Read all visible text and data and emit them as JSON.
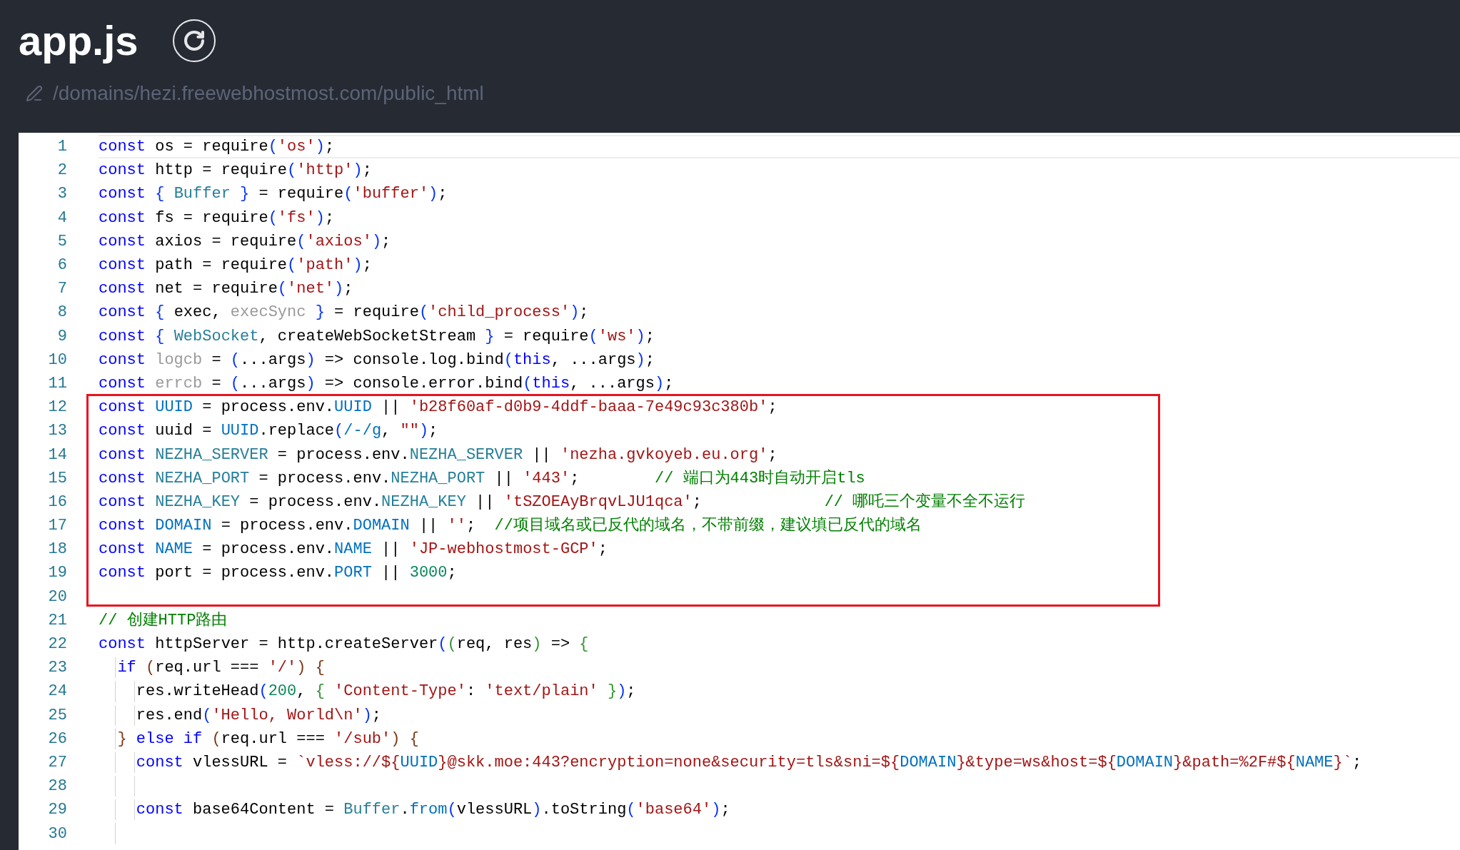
{
  "file": {
    "title": "app.js",
    "path": "/domains/hezi.freewebhostmost.com/public_html"
  },
  "editor": {
    "lines": [
      {
        "number": "1",
        "current": true,
        "tokens": [
          {
            "kind": "keyword",
            "text": "const "
          },
          {
            "kind": "plain",
            "text": "os = require"
          },
          {
            "kind": "bracket1",
            "text": "("
          },
          {
            "kind": "string",
            "text": "'os'"
          },
          {
            "kind": "bracket1",
            "text": ")"
          },
          {
            "kind": "plain",
            "text": ";"
          }
        ]
      },
      {
        "number": "2",
        "current": false,
        "tokens": [
          {
            "kind": "keyword",
            "text": "const "
          },
          {
            "kind": "plain",
            "text": "http = require"
          },
          {
            "kind": "bracket1",
            "text": "("
          },
          {
            "kind": "string",
            "text": "'http'"
          },
          {
            "kind": "bracket1",
            "text": ")"
          },
          {
            "kind": "plain",
            "text": ";"
          }
        ]
      },
      {
        "number": "3",
        "current": false,
        "tokens": [
          {
            "kind": "keyword",
            "text": "const "
          },
          {
            "kind": "bracket1",
            "text": "{ "
          },
          {
            "kind": "type",
            "text": "Buffer "
          },
          {
            "kind": "bracket1",
            "text": "}"
          },
          {
            "kind": "plain",
            "text": " = require"
          },
          {
            "kind": "bracket1",
            "text": "("
          },
          {
            "kind": "string",
            "text": "'buffer'"
          },
          {
            "kind": "bracket1",
            "text": ")"
          },
          {
            "kind": "plain",
            "text": ";"
          }
        ]
      },
      {
        "number": "4",
        "current": false,
        "tokens": [
          {
            "kind": "keyword",
            "text": "const "
          },
          {
            "kind": "plain",
            "text": "fs = require"
          },
          {
            "kind": "bracket1",
            "text": "("
          },
          {
            "kind": "string",
            "text": "'fs'"
          },
          {
            "kind": "bracket1",
            "text": ")"
          },
          {
            "kind": "plain",
            "text": ";"
          }
        ]
      },
      {
        "number": "5",
        "current": false,
        "tokens": [
          {
            "kind": "keyword",
            "text": "const "
          },
          {
            "kind": "plain",
            "text": "axios = require"
          },
          {
            "kind": "bracket1",
            "text": "("
          },
          {
            "kind": "string",
            "text": "'axios'"
          },
          {
            "kind": "bracket1",
            "text": ")"
          },
          {
            "kind": "plain",
            "text": ";"
          }
        ]
      },
      {
        "number": "6",
        "current": false,
        "tokens": [
          {
            "kind": "keyword",
            "text": "const "
          },
          {
            "kind": "plain",
            "text": "path = require"
          },
          {
            "kind": "bracket1",
            "text": "("
          },
          {
            "kind": "string",
            "text": "'path'"
          },
          {
            "kind": "bracket1",
            "text": ")"
          },
          {
            "kind": "plain",
            "text": ";"
          }
        ]
      },
      {
        "number": "7",
        "current": false,
        "tokens": [
          {
            "kind": "keyword",
            "text": "const "
          },
          {
            "kind": "plain",
            "text": "net = require"
          },
          {
            "kind": "bracket1",
            "text": "("
          },
          {
            "kind": "string",
            "text": "'net'"
          },
          {
            "kind": "bracket1",
            "text": ")"
          },
          {
            "kind": "plain",
            "text": ";"
          }
        ]
      },
      {
        "number": "8",
        "current": false,
        "tokens": [
          {
            "kind": "keyword",
            "text": "const "
          },
          {
            "kind": "bracket1",
            "text": "{ "
          },
          {
            "kind": "plain",
            "text": "exec, "
          },
          {
            "kind": "unused",
            "text": "execSync "
          },
          {
            "kind": "bracket1",
            "text": "}"
          },
          {
            "kind": "plain",
            "text": " = require"
          },
          {
            "kind": "bracket1",
            "text": "("
          },
          {
            "kind": "string",
            "text": "'child_process'"
          },
          {
            "kind": "bracket1",
            "text": ")"
          },
          {
            "kind": "plain",
            "text": ";"
          }
        ]
      },
      {
        "number": "9",
        "current": false,
        "tokens": [
          {
            "kind": "keyword",
            "text": "const "
          },
          {
            "kind": "bracket1",
            "text": "{ "
          },
          {
            "kind": "type",
            "text": "WebSocket"
          },
          {
            "kind": "plain",
            "text": ", createWebSocketStream "
          },
          {
            "kind": "bracket1",
            "text": "}"
          },
          {
            "kind": "plain",
            "text": " = require"
          },
          {
            "kind": "bracket1",
            "text": "("
          },
          {
            "kind": "string",
            "text": "'ws'"
          },
          {
            "kind": "bracket1",
            "text": ")"
          },
          {
            "kind": "plain",
            "text": ";"
          }
        ]
      },
      {
        "number": "10",
        "current": false,
        "tokens": [
          {
            "kind": "keyword",
            "text": "const "
          },
          {
            "kind": "unused",
            "text": "logcb"
          },
          {
            "kind": "plain",
            "text": " = "
          },
          {
            "kind": "bracket1",
            "text": "("
          },
          {
            "kind": "plain",
            "text": "...args"
          },
          {
            "kind": "bracket1",
            "text": ")"
          },
          {
            "kind": "plain",
            "text": " => console.log.bind"
          },
          {
            "kind": "bracket1",
            "text": "("
          },
          {
            "kind": "keyword",
            "text": "this"
          },
          {
            "kind": "plain",
            "text": ", ...args"
          },
          {
            "kind": "bracket1",
            "text": ")"
          },
          {
            "kind": "plain",
            "text": ";"
          }
        ]
      },
      {
        "number": "11",
        "current": false,
        "tokens": [
          {
            "kind": "keyword",
            "text": "const "
          },
          {
            "kind": "unused",
            "text": "errcb"
          },
          {
            "kind": "plain",
            "text": " = "
          },
          {
            "kind": "bracket1",
            "text": "("
          },
          {
            "kind": "plain",
            "text": "...args"
          },
          {
            "kind": "bracket1",
            "text": ")"
          },
          {
            "kind": "plain",
            "text": " => console.error.bind"
          },
          {
            "kind": "bracket1",
            "text": "("
          },
          {
            "kind": "keyword",
            "text": "this"
          },
          {
            "kind": "plain",
            "text": ", ...args"
          },
          {
            "kind": "bracket1",
            "text": ")"
          },
          {
            "kind": "plain",
            "text": ";"
          }
        ]
      },
      {
        "number": "12",
        "current": false,
        "tokens": [
          {
            "kind": "keyword",
            "text": "const "
          },
          {
            "kind": "constant",
            "text": "UUID"
          },
          {
            "kind": "plain",
            "text": " = process.env."
          },
          {
            "kind": "constant",
            "text": "UUID"
          },
          {
            "kind": "plain",
            "text": " || "
          },
          {
            "kind": "string",
            "text": "'b28f60af-d0b9-4ddf-baaa-7e49c93c380b'"
          },
          {
            "kind": "plain",
            "text": ";"
          }
        ]
      },
      {
        "number": "13",
        "current": false,
        "tokens": [
          {
            "kind": "keyword",
            "text": "const "
          },
          {
            "kind": "plain",
            "text": "uuid = "
          },
          {
            "kind": "constant",
            "text": "UUID"
          },
          {
            "kind": "plain",
            "text": ".replace"
          },
          {
            "kind": "bracket1",
            "text": "("
          },
          {
            "kind": "constant",
            "text": "/-/g"
          },
          {
            "kind": "plain",
            "text": ", "
          },
          {
            "kind": "string",
            "text": "\"\""
          },
          {
            "kind": "bracket1",
            "text": ")"
          },
          {
            "kind": "plain",
            "text": ";"
          }
        ]
      },
      {
        "number": "14",
        "current": false,
        "tokens": [
          {
            "kind": "keyword",
            "text": "const "
          },
          {
            "kind": "type",
            "text": "NEZHA_SERVER"
          },
          {
            "kind": "plain",
            "text": " = process.env."
          },
          {
            "kind": "type",
            "text": "NEZHA_SERVER"
          },
          {
            "kind": "plain",
            "text": " || "
          },
          {
            "kind": "string",
            "text": "'nezha.gvkoyeb.eu.org'"
          },
          {
            "kind": "plain",
            "text": ";"
          }
        ]
      },
      {
        "number": "15",
        "current": false,
        "tokens": [
          {
            "kind": "keyword",
            "text": "const "
          },
          {
            "kind": "type",
            "text": "NEZHA_PORT"
          },
          {
            "kind": "plain",
            "text": " = process.env."
          },
          {
            "kind": "type",
            "text": "NEZHA_PORT"
          },
          {
            "kind": "plain",
            "text": " || "
          },
          {
            "kind": "string",
            "text": "'443'"
          },
          {
            "kind": "plain",
            "text": ";        "
          },
          {
            "kind": "comment",
            "text": "// 端口为443时自动开启tls"
          }
        ]
      },
      {
        "number": "16",
        "current": false,
        "tokens": [
          {
            "kind": "keyword",
            "text": "const "
          },
          {
            "kind": "type",
            "text": "NEZHA_KEY"
          },
          {
            "kind": "plain",
            "text": " = process.env."
          },
          {
            "kind": "type",
            "text": "NEZHA_KEY"
          },
          {
            "kind": "plain",
            "text": " || "
          },
          {
            "kind": "string",
            "text": "'tSZOEAyBrqvLJU1qca'"
          },
          {
            "kind": "plain",
            "text": ";             "
          },
          {
            "kind": "comment",
            "text": "// 哪吒三个变量不全不运行"
          }
        ]
      },
      {
        "number": "17",
        "current": false,
        "tokens": [
          {
            "kind": "keyword",
            "text": "const "
          },
          {
            "kind": "constant",
            "text": "DOMAIN"
          },
          {
            "kind": "plain",
            "text": " = process.env."
          },
          {
            "kind": "constant",
            "text": "DOMAIN"
          },
          {
            "kind": "plain",
            "text": " || "
          },
          {
            "kind": "string",
            "text": "''"
          },
          {
            "kind": "plain",
            "text": ";  "
          },
          {
            "kind": "comment",
            "text": "//项目域名或已反代的域名，不带前缀，建议填已反代的域名"
          }
        ]
      },
      {
        "number": "18",
        "current": false,
        "tokens": [
          {
            "kind": "keyword",
            "text": "const "
          },
          {
            "kind": "constant",
            "text": "NAME"
          },
          {
            "kind": "plain",
            "text": " = process.env."
          },
          {
            "kind": "constant",
            "text": "NAME"
          },
          {
            "kind": "plain",
            "text": " || "
          },
          {
            "kind": "string",
            "text": "'JP-webhostmost-GCP'"
          },
          {
            "kind": "plain",
            "text": ";"
          }
        ]
      },
      {
        "number": "19",
        "current": false,
        "tokens": [
          {
            "kind": "keyword",
            "text": "const "
          },
          {
            "kind": "plain",
            "text": "port = process.env."
          },
          {
            "kind": "constant",
            "text": "PORT"
          },
          {
            "kind": "plain",
            "text": " || "
          },
          {
            "kind": "number",
            "text": "3000"
          },
          {
            "kind": "plain",
            "text": ";"
          }
        ]
      },
      {
        "number": "20",
        "current": false
      },
      {
        "number": "21",
        "current": false,
        "tokens": [
          {
            "kind": "comment",
            "text": "// 创建HTTP路由"
          }
        ]
      },
      {
        "number": "22",
        "current": false,
        "tokens": [
          {
            "kind": "keyword",
            "text": "const "
          },
          {
            "kind": "plain",
            "text": "httpServer = http.createServer"
          },
          {
            "kind": "bracket1",
            "text": "("
          },
          {
            "kind": "bracket2",
            "text": "("
          },
          {
            "kind": "plain",
            "text": "req, res"
          },
          {
            "kind": "bracket2",
            "text": ")"
          },
          {
            "kind": "plain",
            "text": " => "
          },
          {
            "kind": "bracket2",
            "text": "{"
          }
        ],
        "children": [
          {
            "number": "23",
            "current": false,
            "tokens": [
              {
                "kind": "keyword",
                "text": "if "
              },
              {
                "kind": "bracket3",
                "text": "("
              },
              {
                "kind": "plain",
                "text": "req.url === "
              },
              {
                "kind": "string",
                "text": "'/'"
              },
              {
                "kind": "bracket3",
                "text": ")"
              },
              {
                "kind": "bracket3",
                "text": " {"
              }
            ],
            "children": [
              {
                "number": "24",
                "current": false,
                "tokens": [
                  {
                    "kind": "plain",
                    "text": "res.writeHead"
                  },
                  {
                    "kind": "bracket1",
                    "text": "("
                  },
                  {
                    "kind": "number",
                    "text": "200"
                  },
                  {
                    "kind": "plain",
                    "text": ", "
                  },
                  {
                    "kind": "bracket2",
                    "text": "{ "
                  },
                  {
                    "kind": "string",
                    "text": "'Content-Type'"
                  },
                  {
                    "kind": "plain",
                    "text": ": "
                  },
                  {
                    "kind": "string",
                    "text": "'text/plain'"
                  },
                  {
                    "kind": "bracket2",
                    "text": " }"
                  },
                  {
                    "kind": "bracket1",
                    "text": ")"
                  },
                  {
                    "kind": "plain",
                    "text": ";"
                  }
                ]
              },
              {
                "number": "25",
                "current": false,
                "tokens": [
                  {
                    "kind": "plain",
                    "text": "res.end"
                  },
                  {
                    "kind": "bracket1",
                    "text": "("
                  },
                  {
                    "kind": "string",
                    "text": "'Hello, World\\n'"
                  },
                  {
                    "kind": "bracket1",
                    "text": ")"
                  },
                  {
                    "kind": "plain",
                    "text": ";"
                  }
                ]
              }
            ]
          },
          {
            "number": "26",
            "current": false,
            "tokens": [
              {
                "kind": "bracket3",
                "text": "}"
              },
              {
                "kind": "keyword",
                "text": " else if "
              },
              {
                "kind": "bracket3",
                "text": "("
              },
              {
                "kind": "plain",
                "text": "req.url === "
              },
              {
                "kind": "string",
                "text": "'/sub'"
              },
              {
                "kind": "bracket3",
                "text": ")"
              },
              {
                "kind": "bracket3",
                "text": " {"
              }
            ],
            "children": [
              {
                "number": "27",
                "current": false,
                "tokens": [
                  {
                    "kind": "keyword",
                    "text": "const "
                  },
                  {
                    "kind": "plain",
                    "text": "vlessURL = "
                  },
                  {
                    "kind": "string",
                    "text": "`vless://${"
                  },
                  {
                    "kind": "constant",
                    "text": "UUID"
                  },
                  {
                    "kind": "string",
                    "text": "}@skk.moe:443?encryption=none&security=tls&sni=${"
                  },
                  {
                    "kind": "constant",
                    "text": "DOMAIN"
                  },
                  {
                    "kind": "string",
                    "text": "}&type=ws&host=${"
                  },
                  {
                    "kind": "constant",
                    "text": "DOMAIN"
                  },
                  {
                    "kind": "string",
                    "text": "}&path=%2F#${"
                  },
                  {
                    "kind": "constant",
                    "text": "NAME"
                  },
                  {
                    "kind": "string",
                    "text": "}`"
                  },
                  {
                    "kind": "plain",
                    "text": ";"
                  }
                ]
              },
              {
                "number": "28",
                "current": false
              },
              {
                "number": "29",
                "current": false,
                "tokens": [
                  {
                    "kind": "keyword",
                    "text": "const "
                  },
                  {
                    "kind": "plain",
                    "text": "base64Content = "
                  },
                  {
                    "kind": "type",
                    "text": "Buffer"
                  },
                  {
                    "kind": "plain",
                    "text": "."
                  },
                  {
                    "kind": "constant",
                    "text": "from"
                  },
                  {
                    "kind": "bracket1",
                    "text": "("
                  },
                  {
                    "kind": "plain",
                    "text": "vlessURL"
                  },
                  {
                    "kind": "bracket1",
                    "text": ")"
                  },
                  {
                    "kind": "plain",
                    "text": ".toString"
                  },
                  {
                    "kind": "bracket1",
                    "text": "("
                  },
                  {
                    "kind": "string",
                    "text": "'base64'"
                  },
                  {
                    "kind": "bracket1",
                    "text": ")"
                  },
                  {
                    "kind": "plain",
                    "text": ";"
                  }
                ]
              }
            ]
          },
          {
            "number": "30",
            "current": false
          }
        ]
      }
    ]
  }
}
